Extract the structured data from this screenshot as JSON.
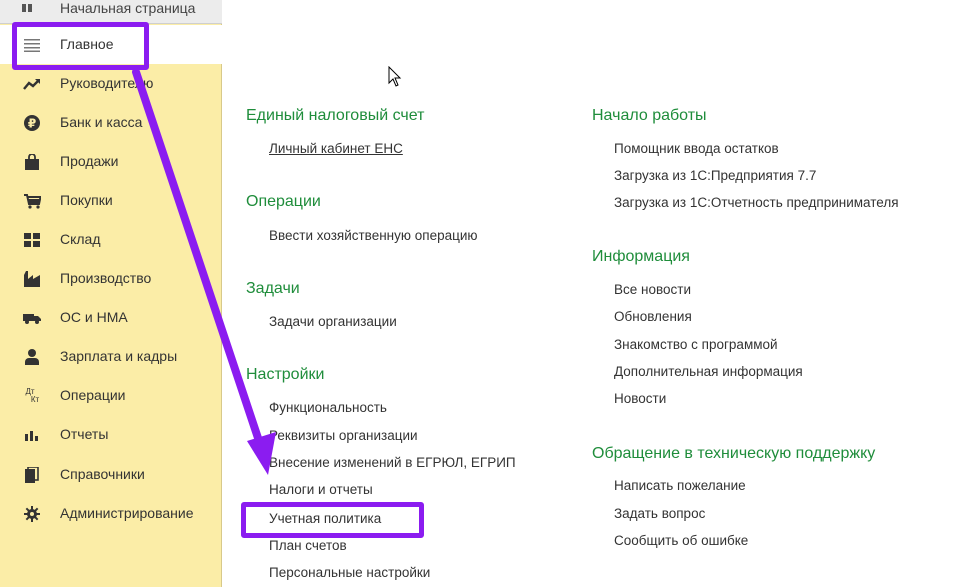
{
  "sidebar": {
    "top_item": "Начальная страница",
    "items": [
      {
        "label": "Главное",
        "icon": "menu-lines-icon"
      },
      {
        "label": "Руководителю",
        "icon": "trend-up-icon"
      },
      {
        "label": "Банк и касса",
        "icon": "ruble-coin-icon"
      },
      {
        "label": "Продажи",
        "icon": "shopping-bag-icon"
      },
      {
        "label": "Покупки",
        "icon": "shopping-cart-icon"
      },
      {
        "label": "Склад",
        "icon": "warehouse-grid-icon"
      },
      {
        "label": "Производство",
        "icon": "factory-icon"
      },
      {
        "label": "ОС и НМА",
        "icon": "truck-icon"
      },
      {
        "label": "Зарплата и кадры",
        "icon": "person-icon"
      },
      {
        "label": "Операции",
        "icon": "debit-credit-icon"
      },
      {
        "label": "Отчеты",
        "icon": "bar-chart-icon"
      },
      {
        "label": "Справочники",
        "icon": "books-icon"
      },
      {
        "label": "Администрирование",
        "icon": "gear-icon"
      }
    ]
  },
  "icons": {
    "debit": "Дт",
    "credit": "Кт"
  },
  "main": {
    "ens": {
      "title": "Единый налоговый счет",
      "links": [
        "Личный кабинет ЕНС"
      ]
    },
    "operations": {
      "title": "Операции",
      "links": [
        "Ввести хозяйственную операцию"
      ]
    },
    "tasks": {
      "title": "Задачи",
      "links": [
        "Задачи организации"
      ]
    },
    "settings": {
      "title": "Настройки",
      "links": [
        "Функциональность",
        "Реквизиты организации",
        "Внесение изменений в ЕГРЮЛ, ЕГРИП",
        "Налоги и отчеты",
        "Учетная политика",
        "План счетов",
        "Персональные настройки"
      ]
    },
    "start": {
      "title": "Начало работы",
      "links": [
        "Помощник ввода остатков",
        "Загрузка из 1С:Предприятия 7.7",
        "Загрузка из 1С:Отчетность предпринимателя"
      ]
    },
    "info": {
      "title": "Информация",
      "links": [
        "Все новости",
        "Обновления",
        "Знакомство с программой",
        "Дополнительная информация",
        "Новости"
      ]
    },
    "support": {
      "title": "Обращение в техническую поддержку",
      "links": [
        "Написать пожелание",
        "Задать вопрос",
        "Сообщить об ошибке"
      ]
    }
  },
  "colors": {
    "sidebar_bg": "#fbeda7",
    "section_title": "#1f8d3b",
    "highlight": "#8b1cf0"
  }
}
